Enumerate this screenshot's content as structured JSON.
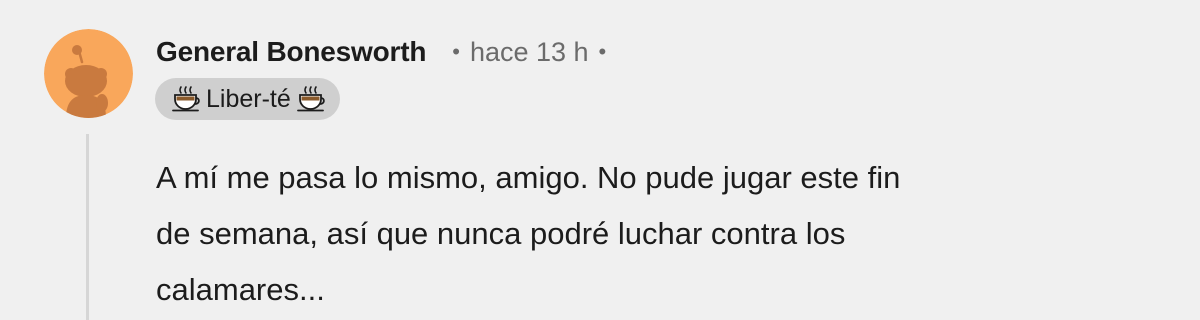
{
  "comment": {
    "author": "General Bonesworth",
    "separator": "•",
    "timestamp": "hace 13 h",
    "flair": {
      "text": "Liber-té",
      "left_icon": "teacup-icon",
      "right_icon": "teacup-icon"
    },
    "avatar_icon": "snoo-avatar-icon",
    "body_lines": [
      "A mí me pasa lo mismo, amigo. No pude jugar este fin",
      "de semana, así que nunca podré luchar contra los",
      "calamares..."
    ]
  },
  "colors": {
    "background": "#f0f0f0",
    "avatar_background": "#f9a75b",
    "avatar_figure": "#c97a3f",
    "flair_background": "#cfcfcf",
    "text": "#1c1c1c",
    "meta": "#6b6b6b",
    "thread_line": "#d6d6d6"
  }
}
